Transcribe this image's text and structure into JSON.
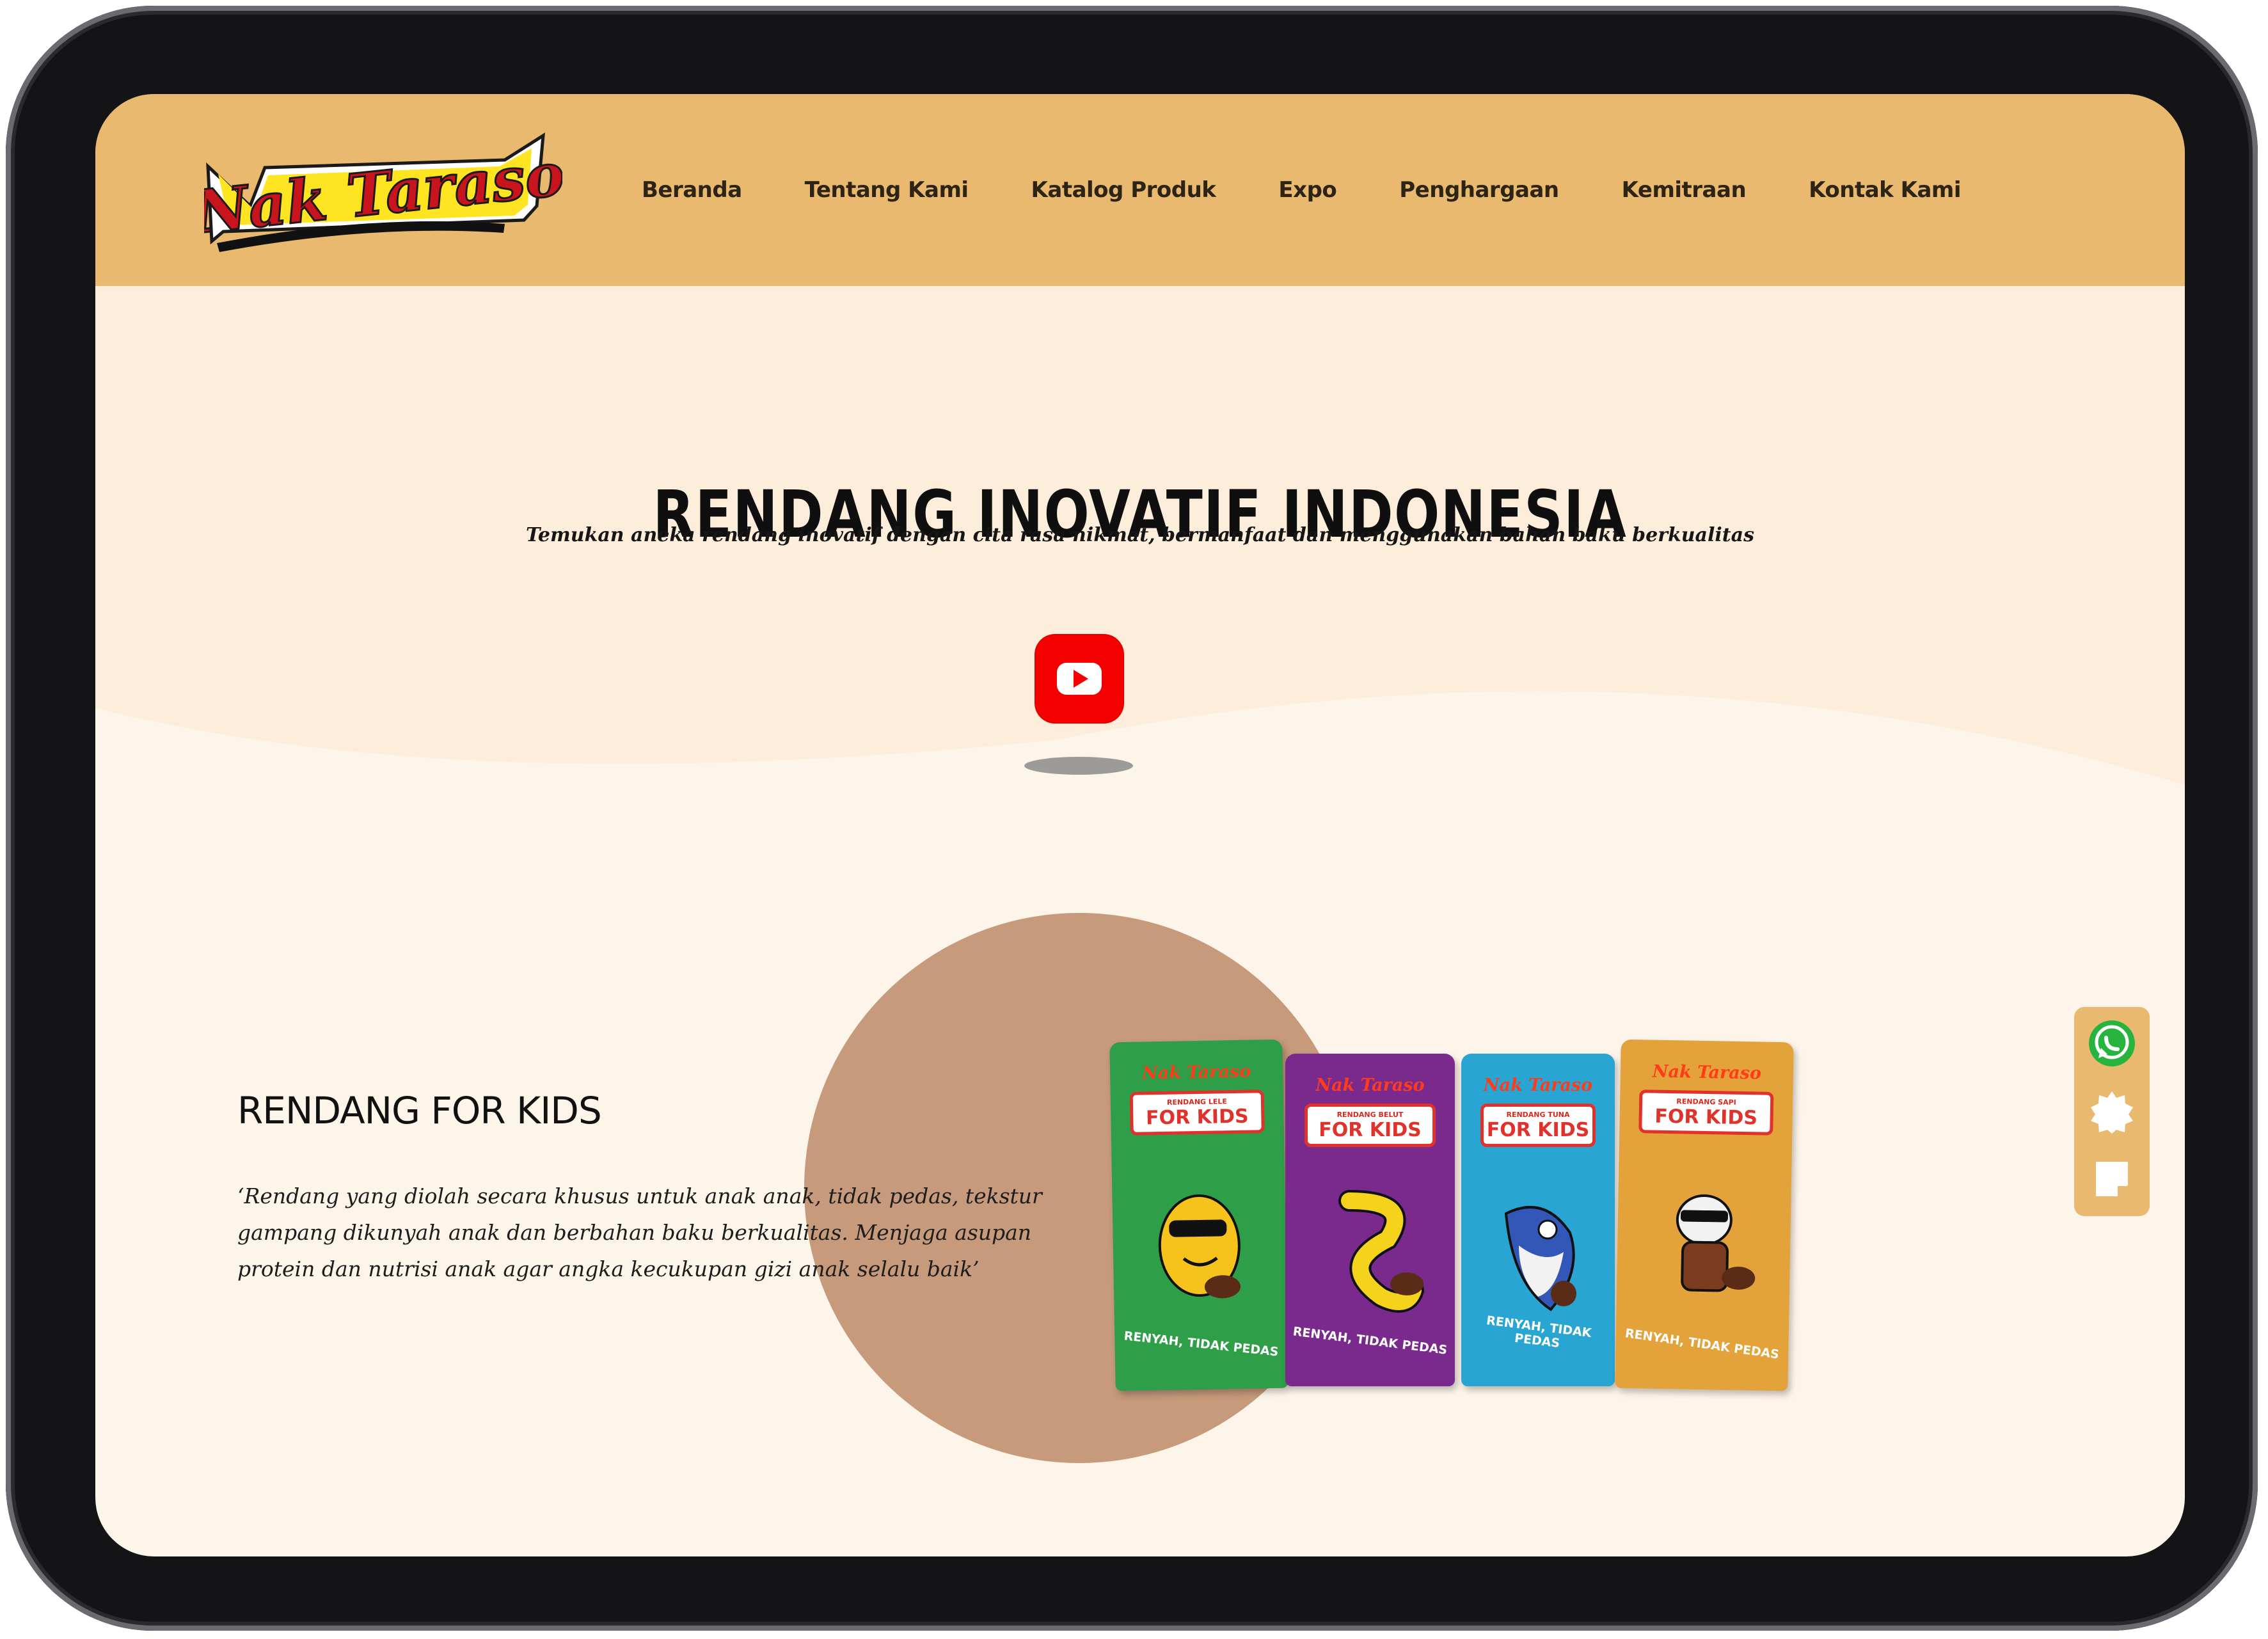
{
  "brand": {
    "logo_text": "Nak Taraso"
  },
  "nav": {
    "items": [
      {
        "label": "Beranda"
      },
      {
        "label": "Tentang Kami"
      },
      {
        "label": "Katalog Produk"
      },
      {
        "label": "Expo"
      },
      {
        "label": "Penghargaan"
      },
      {
        "label": "Kemitraan"
      },
      {
        "label": "Kontak Kami"
      }
    ]
  },
  "hero": {
    "title": "RENDANG INOVATIF INDONESIA",
    "subtitle": "Temukan aneka rendang inovatif dengan cita rasa nikmat, bermanfaat dan menggunakan bahan baku berkualitas",
    "video_button_icon": "youtube-play-icon"
  },
  "kids": {
    "title": "RENDANG FOR KIDS",
    "description": "‘Rendang yang diolah secara khusus untuk anak anak, tidak pedas, tekstur gampang dikunyah anak dan berbahan baku berkualitas. Menjaga asupan protein dan nutrisi anak agar angka kecukupan gizi anak selalu baik’"
  },
  "products": [
    {
      "brand": "Nak Taraso",
      "sub": "RENDANG LELE",
      "kids": "FOR KIDS",
      "foot": "RENYAH, TIDAK PEDAS",
      "color": "#2f9e48"
    },
    {
      "brand": "Nak Taraso",
      "sub": "RENDANG BELUT",
      "kids": "FOR KIDS",
      "foot": "RENYAH, TIDAK PEDAS",
      "color": "#7a2a8c"
    },
    {
      "brand": "Nak Taraso",
      "sub": "RENDANG TUNA",
      "kids": "FOR KIDS",
      "foot": "RENYAH, TIDAK PEDAS",
      "color": "#29a5d3"
    },
    {
      "brand": "Nak Taraso",
      "sub": "RENDANG SAPI",
      "kids": "FOR KIDS",
      "foot": "RENYAH, TIDAK PEDAS",
      "color": "#e3a23a"
    }
  ],
  "float_actions": [
    {
      "icon": "whatsapp-icon"
    },
    {
      "icon": "badge-icon"
    },
    {
      "icon": "note-icon"
    }
  ],
  "colors": {
    "nav_bg": "#e8b96f",
    "hero_bg": "#fdeedc",
    "page_bg": "#fdf5ea",
    "circle": "#c69a7b",
    "youtube": "#f40000"
  }
}
